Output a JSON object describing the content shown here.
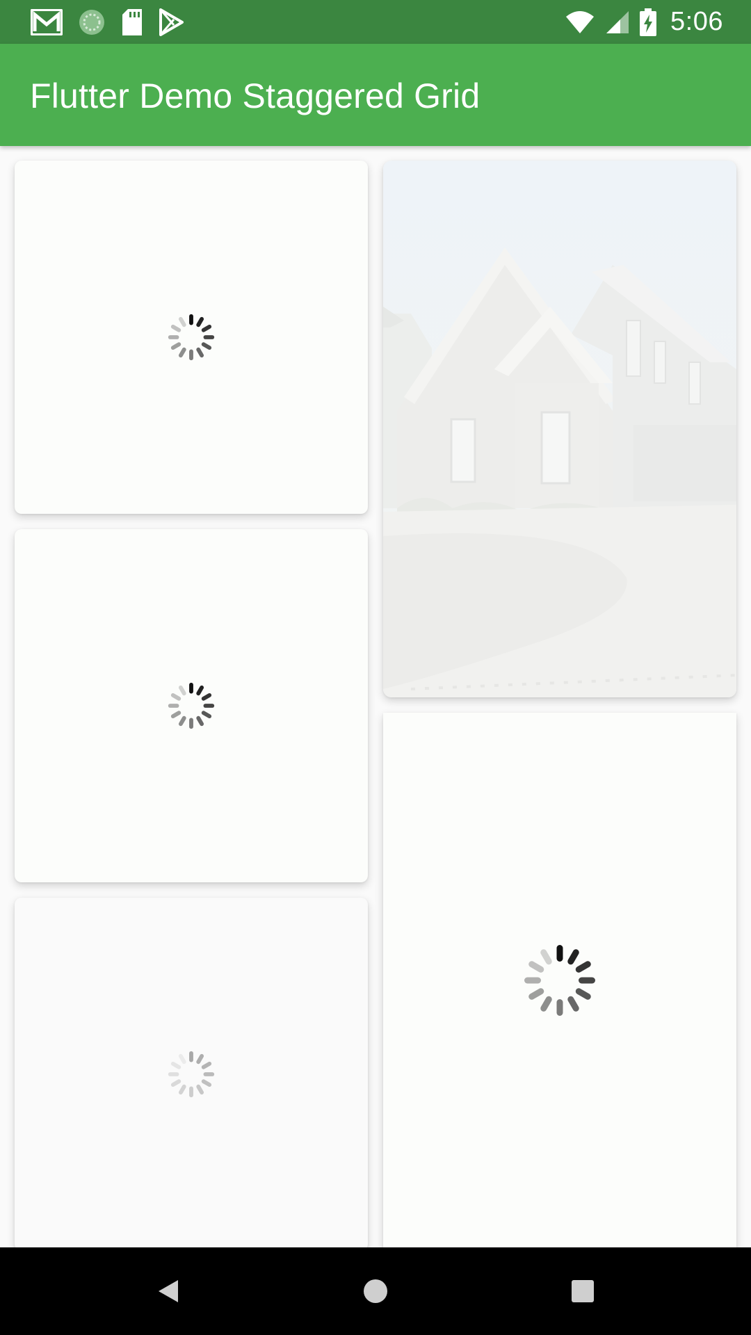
{
  "status_bar": {
    "time": "5:06",
    "left_icons": [
      "gmail-icon",
      "sync-icon",
      "sd-card-icon",
      "play-store-icon"
    ],
    "right_icons": [
      "wifi-icon",
      "cell-signal-icon",
      "battery-charging-icon"
    ],
    "background_color": "#3b8640"
  },
  "app_bar": {
    "title": "Flutter Demo Staggered Grid",
    "background_color": "#4caf50"
  },
  "grid": {
    "tiles": [
      {
        "state": "loading"
      },
      {
        "state": "image",
        "image": "house-photo"
      },
      {
        "state": "loading"
      },
      {
        "state": "loading"
      },
      {
        "state": "loading"
      }
    ]
  },
  "nav_bar": {
    "buttons": [
      "back-icon",
      "home-icon",
      "recents-icon"
    ]
  }
}
